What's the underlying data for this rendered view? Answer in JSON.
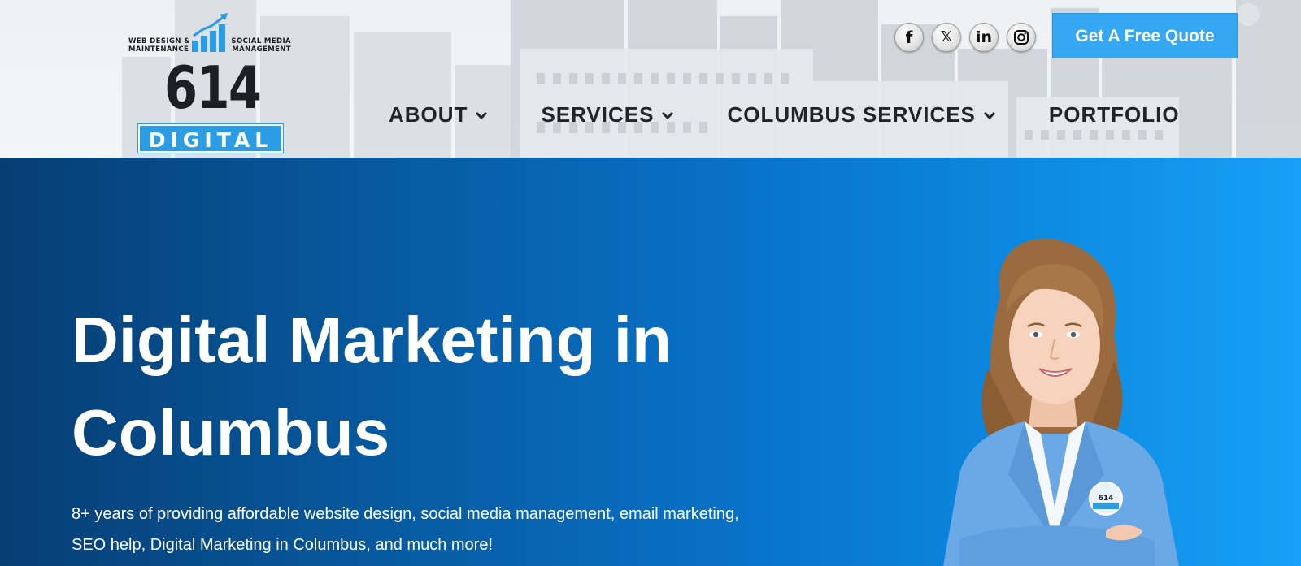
{
  "logo": {
    "left_tagline": [
      "WEB DESIGN &",
      "MAINTENANCE"
    ],
    "right_tagline": [
      "SOCIAL MEDIA",
      "MANAGEMENT"
    ],
    "number": "614",
    "word": "DIGITAL"
  },
  "social": {
    "facebook": "f",
    "x": "𝕏",
    "linkedin": "in"
  },
  "quote_button": "Get A Free Quote",
  "nav": {
    "about": "ABOUT",
    "services": "SERVICES",
    "columbus_services": "COLUMBUS SERVICES",
    "portfolio": "PORTFOLIO"
  },
  "hero": {
    "title_line1": "Digital Marketing in",
    "title_line2": "Columbus",
    "subtitle_line1": "8+ years of providing affordable website design, social media management, email marketing,",
    "subtitle_line2": "SEO help, Digital Marketing in Columbus, and much more!",
    "badge_text": "614"
  },
  "colors": {
    "accent": "#35a8f3",
    "hero_dark": "#073e74",
    "hero_light": "#17a0f5",
    "nav_text": "#222428"
  },
  "icons": [
    "facebook-icon",
    "x-icon",
    "linkedin-icon",
    "instagram-icon",
    "chevron-down-icon",
    "growth-chart-icon"
  ]
}
